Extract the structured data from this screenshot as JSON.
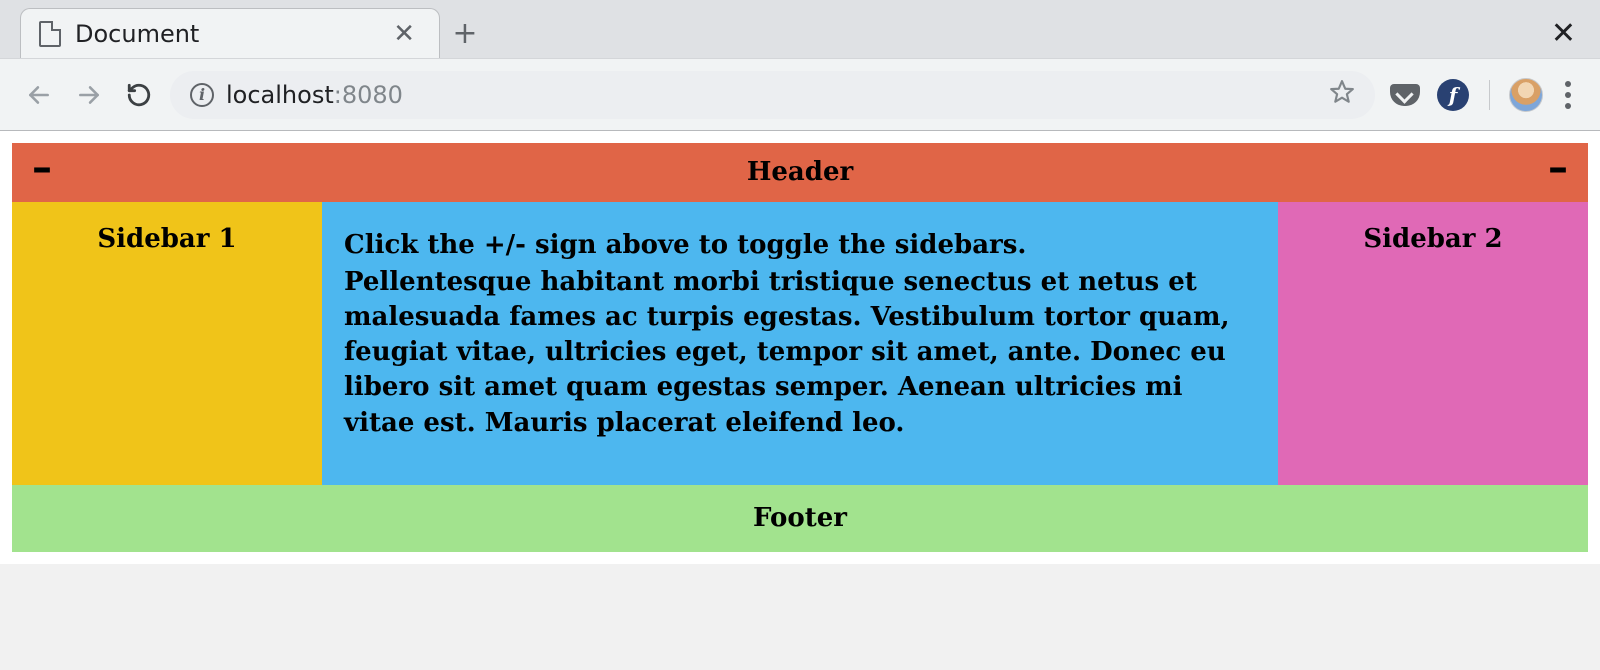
{
  "browser": {
    "tab_title": "Document",
    "url_host": "localhost",
    "url_port": ":8080",
    "toggle_glyph": "–",
    "fedora_glyph": "f",
    "info_glyph": "i"
  },
  "page": {
    "header": "Header",
    "sidebar1": "Sidebar 1",
    "sidebar2": "Sidebar 2",
    "footer": "Footer",
    "main_instruction": "Click the +/- sign above to toggle the sidebars.",
    "main_body": "Pellentesque habitant morbi tristique senectus et netus et malesuada fames ac turpis egestas. Vestibulum tortor quam, feugiat vitae, ultricies eget, tempor sit amet, ante. Donec eu libero sit amet quam egestas semper. Aenean ultricies mi vitae est. Mauris placerat eleifend leo."
  },
  "colors": {
    "header": "#e06547",
    "sidebar1": "#f0c419",
    "main": "#4db7ef",
    "sidebar2": "#e069b6",
    "footer": "#a2e38e"
  }
}
